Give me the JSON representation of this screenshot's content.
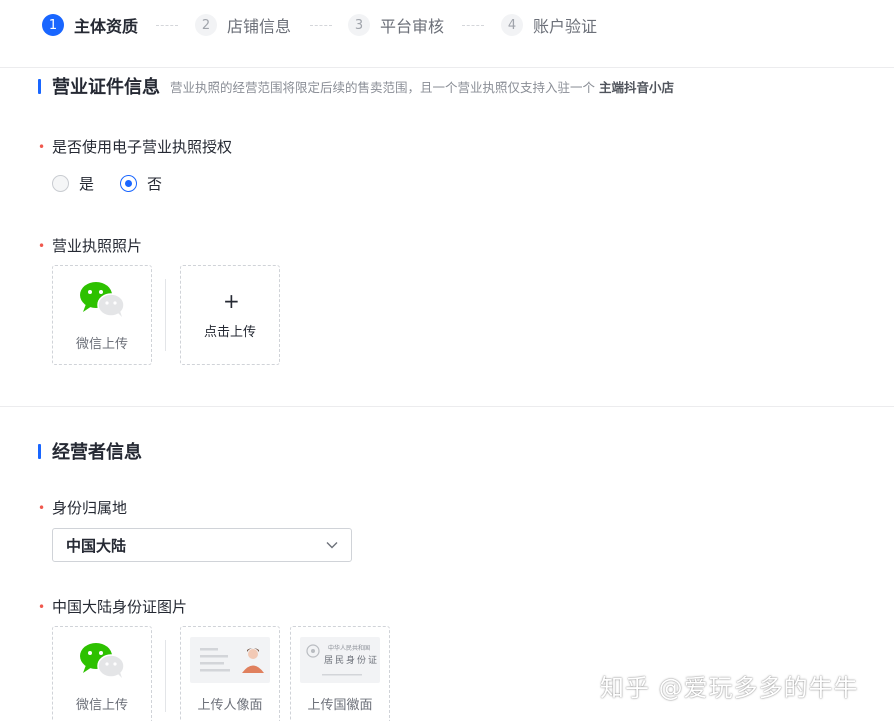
{
  "steps": [
    {
      "num": "1",
      "label": "主体资质",
      "active": true
    },
    {
      "num": "2",
      "label": "店铺信息",
      "active": false
    },
    {
      "num": "3",
      "label": "平台审核",
      "active": false
    },
    {
      "num": "4",
      "label": "账户验证",
      "active": false
    }
  ],
  "section_license": {
    "title": "营业证件信息",
    "note": "营业执照的经营范围将限定后续的售卖范围，且一个营业执照仅支持入驻一个",
    "note_strong": "主端抖音小店"
  },
  "e_license_field": {
    "label": "是否使用电子营业执照授权",
    "options": [
      "是",
      "否"
    ],
    "selected": "否"
  },
  "license_photo": {
    "label": "营业执照照片",
    "wechat_upload": "微信上传",
    "click_upload": "点击上传",
    "plus": "+"
  },
  "section_operator": {
    "title": "经营者信息"
  },
  "id_region": {
    "label": "身份归属地",
    "value": "中国大陆"
  },
  "id_photo": {
    "label": "中国大陆身份证图片",
    "wechat_upload": "微信上传",
    "portrait_upload": "上传人像面",
    "emblem_upload": "上传国徽面",
    "card_line1": "中华人民共和国",
    "card_line2": "居民身份证"
  },
  "watermark": "知乎 @爱玩多多的牛牛",
  "colors": {
    "accent": "#1966ff",
    "required": "#f0584d",
    "wechat": "#2dc100"
  }
}
